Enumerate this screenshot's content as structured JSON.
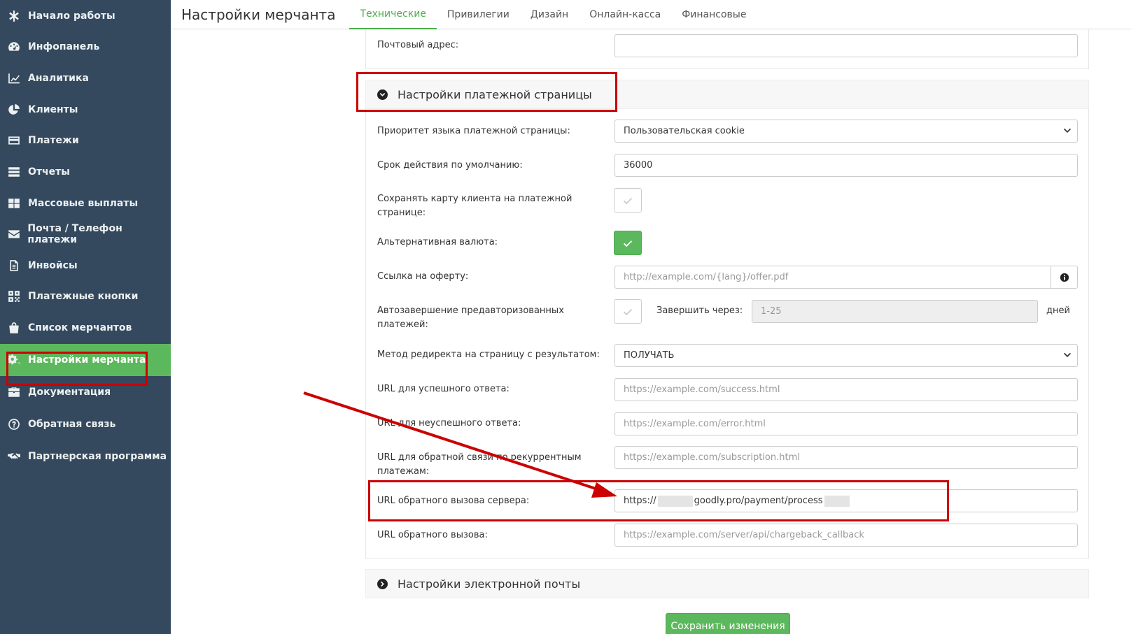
{
  "sidebar": {
    "items": [
      {
        "label": "Начало работы",
        "icon": "asterisk-icon"
      },
      {
        "label": "Инфопанель",
        "icon": "dashboard-icon"
      },
      {
        "label": "Аналитика",
        "icon": "line-chart-icon"
      },
      {
        "label": "Клиенты",
        "icon": "pie-chart-icon"
      },
      {
        "label": "Платежи",
        "icon": "credit-card-icon"
      },
      {
        "label": "Отчеты",
        "icon": "list-icon"
      },
      {
        "label": "Массовые выплаты",
        "icon": "grid-icon"
      },
      {
        "label": "Почта / Телефон платежи",
        "icon": "envelope-icon"
      },
      {
        "label": "Инвойсы",
        "icon": "document-icon"
      },
      {
        "label": "Платежные кнопки",
        "icon": "qr-code-icon"
      },
      {
        "label": "Список мерчантов",
        "icon": "shopping-bag-icon"
      },
      {
        "label": "Настройки мерчанта",
        "icon": "cogs-icon",
        "active": true
      },
      {
        "label": "Документация",
        "icon": "briefcase-icon"
      },
      {
        "label": "Обратная связь",
        "icon": "question-circle-icon"
      },
      {
        "label": "Партнерская программа",
        "icon": "handshake-icon"
      }
    ]
  },
  "header": {
    "title": "Настройки мерчанта",
    "tabs": [
      "Технические",
      "Привилегии",
      "Дизайн",
      "Онлайн-касса",
      "Финансовые"
    ],
    "active_tab": "Технические"
  },
  "top_section": {
    "email_label": "Почтовый адрес:",
    "email_value": ""
  },
  "payment_page": {
    "title": "Настройки платежной страницы",
    "language_label": "Приоритет языка платежной страницы:",
    "language_value": "Пользовательская cookie",
    "ttl_label": "Срок действия по умолчанию:",
    "ttl_value": "36000",
    "save_card_label": "Сохранять карту клиента на платежной странице:",
    "save_card_checked": false,
    "alt_currency_label": "Альтернативная валюта:",
    "alt_currency_checked": true,
    "offer_label": "Ссылка на оферту:",
    "offer_placeholder": "http://example.com/{lang}/offer.pdf",
    "autocomplete_label": "Автозавершение предавторизованных платежей:",
    "autocomplete_checked": false,
    "complete_after_label": "Завершить через:",
    "complete_after_placeholder": "1-25",
    "days_label": "дней",
    "redirect_method_label": "Метод редиректа на страницу с результатом:",
    "redirect_method_value": "ПОЛУЧАТЬ",
    "success_url_label": "URL для успешного ответа:",
    "success_url_placeholder": "https://example.com/success.html",
    "error_url_label": "URL для неуспешного ответа:",
    "error_url_placeholder": "https://example.com/error.html",
    "recurring_url_label": "URL для обратной связи по рекуррентным платежам:",
    "recurring_url_placeholder": "https://example.com/subscription.html",
    "server_callback_label": "URL обратного вызова сервера:",
    "server_callback_prefix": "https://",
    "server_callback_main": "goodly.pro/payment/process",
    "callback_label": "URL обратного вызова:",
    "callback_placeholder": "https://example.com/server/api/chargeback_callback"
  },
  "email_section": {
    "title": "Настройки электронной почты"
  },
  "save_button": "Сохранить изменения",
  "colors": {
    "sidebar_bg": "#34495e",
    "accent_green": "#5cb85c",
    "highlight_red": "#c00000"
  }
}
